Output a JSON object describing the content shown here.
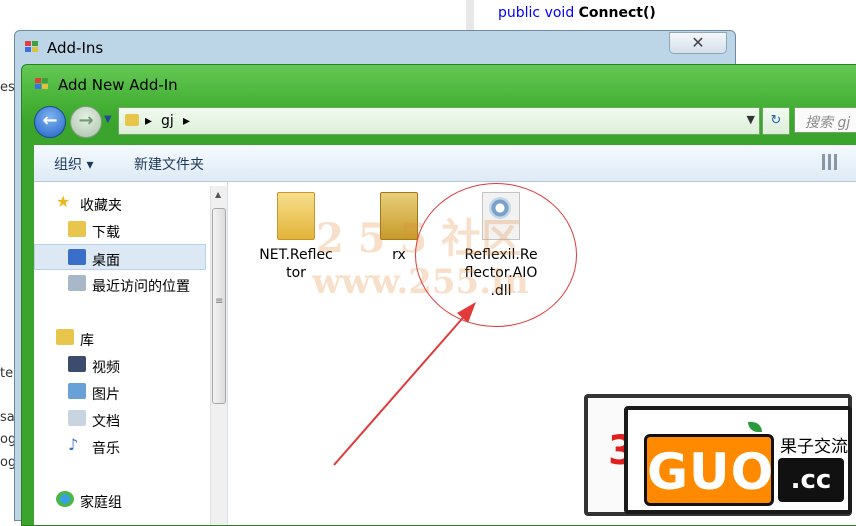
{
  "ide": {
    "code_line_keywords": "public void",
    "code_line_method": "Connect()",
    "left_fragments": [
      "es",
      "te",
      "sa",
      "og",
      "og"
    ]
  },
  "addins_window": {
    "title": "Add-Ins",
    "close_label": "✕"
  },
  "dialog": {
    "title": "Add New Add-In",
    "address": {
      "segment": "gj"
    },
    "search_placeholder": "搜索 gj",
    "toolbar": {
      "organize": "组织 ▾",
      "new_folder": "新建文件夹"
    },
    "sidebar": {
      "favorites_header": "收藏夹",
      "favorites": [
        "下载",
        "桌面",
        "最近访问的位置"
      ],
      "libraries_header": "库",
      "libraries": [
        "视频",
        "图片",
        "文档",
        "音乐"
      ],
      "homegroup": "家庭组"
    },
    "files": [
      {
        "name": "NET.Reflec\ntor",
        "type": "folder"
      },
      {
        "name": "rx",
        "type": "folder"
      },
      {
        "name": "Reflexil.Re\nflector.AIO\n.dll",
        "type": "dll"
      }
    ]
  },
  "overlays": {
    "watermark_top": "2 5 5 社区",
    "watermark_url": "www.255.in",
    "stamp_brand": "GUO",
    "stamp_cn": "果子交流",
    "stamp_tld": ".cc",
    "stamp_digit": "3"
  },
  "colors": {
    "annotation": "#e03a3a",
    "window_green": "#44b034",
    "stamp_orange": "#ff8a00"
  }
}
